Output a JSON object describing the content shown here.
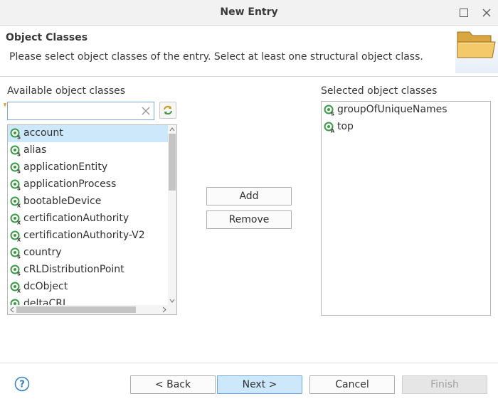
{
  "window": {
    "title": "New Entry"
  },
  "header": {
    "title": "Object Classes",
    "description": "Please select object classes of the entry. Select at least one structural object class."
  },
  "available": {
    "label": "Available object classes",
    "filter_value": "",
    "items": [
      {
        "label": "account",
        "type": "S",
        "selected": true
      },
      {
        "label": "alias",
        "type": "S",
        "selected": false
      },
      {
        "label": "applicationEntity",
        "type": "S",
        "selected": false
      },
      {
        "label": "applicationProcess",
        "type": "S",
        "selected": false
      },
      {
        "label": "bootableDevice",
        "type": "X",
        "selected": false
      },
      {
        "label": "certificationAuthority",
        "type": "X",
        "selected": false
      },
      {
        "label": "certificationAuthority-V2",
        "type": "X",
        "selected": false
      },
      {
        "label": "country",
        "type": "S",
        "selected": false
      },
      {
        "label": "cRLDistributionPoint",
        "type": "S",
        "selected": false
      },
      {
        "label": "dcObject",
        "type": "X",
        "selected": false
      },
      {
        "label": "deltaCRL",
        "type": "X",
        "selected": false
      }
    ]
  },
  "selected": {
    "label": "Selected object classes",
    "items": [
      {
        "label": "groupOfUniqueNames",
        "type": "S"
      },
      {
        "label": "top",
        "type": "A"
      }
    ]
  },
  "buttons": {
    "add": "Add",
    "remove": "Remove",
    "back": "< Back",
    "next": "Next >",
    "cancel": "Cancel",
    "finish": "Finish"
  },
  "colors": {
    "selection": "#cde8fb",
    "icon_green": "#3d9a47",
    "default_button": "#cde8fb",
    "help_blue": "#2f7fc4"
  },
  "icons": {
    "window_maximize": "maximize-icon",
    "window_close": "close-icon",
    "header": "folder-icon",
    "filter_clear": "clear-icon",
    "sync": "sync-icon",
    "object_class": "object-class-icon",
    "help": "help-icon"
  }
}
